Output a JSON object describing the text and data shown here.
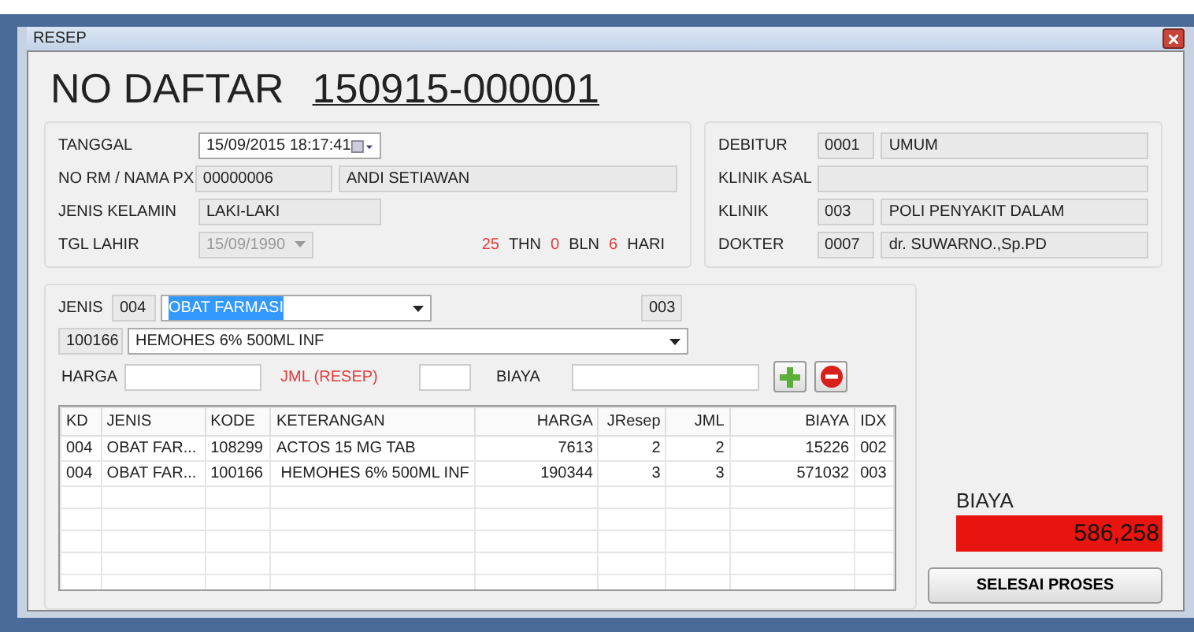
{
  "window": {
    "title": "RESEP"
  },
  "header": {
    "label": "NO DAFTAR",
    "value": "150915-000001"
  },
  "patient": {
    "tanggal": {
      "label": "TANGGAL",
      "value": "15/09/2015 18:17:41"
    },
    "no_rm": {
      "label": "NO RM / NAMA PX",
      "code": "00000006",
      "name": "ANDI SETIAWAN"
    },
    "jenis_kelamin": {
      "label": "JENIS KELAMIN",
      "value": "LAKI-LAKI"
    },
    "tgl_lahir": {
      "label": "TGL LAHIR",
      "value": "15/09/1990",
      "disabled": true
    },
    "age": [
      {
        "value": "25",
        "unit": "THN"
      },
      {
        "value": "0",
        "unit": "BLN"
      },
      {
        "value": "6",
        "unit": "HARI"
      }
    ]
  },
  "registration": [
    {
      "label": "DEBITUR",
      "code": "0001",
      "name": "UMUM"
    },
    {
      "label": "KLINIK ASAL"
    },
    {
      "label": "KLINIK",
      "code": "003",
      "name": "POLI PENYAKIT DALAM"
    },
    {
      "label": "DOKTER",
      "code": "0007",
      "name": "dr. SUWARNO.,Sp.PD"
    }
  ],
  "entry": {
    "jenis": {
      "label": "JENIS",
      "code": "004",
      "value": "OBAT FARMASI",
      "text_selected": true
    },
    "index_code": "003",
    "obat": {
      "code": "100166",
      "value": "HEMOHES 6% 500ML INF"
    },
    "fields": [
      {
        "label": "HARGA",
        "required": false
      },
      {
        "label": "JML (RESEP)",
        "required": true
      },
      {
        "label": "BIAYA",
        "required": false
      }
    ]
  },
  "table": {
    "columns": [
      {
        "label": "KD",
        "numeric": false
      },
      {
        "label": "JENIS",
        "numeric": false
      },
      {
        "label": "KODE",
        "numeric": false
      },
      {
        "label": "KETERANGAN",
        "numeric": false
      },
      {
        "label": "HARGA",
        "numeric": true
      },
      {
        "label": "JResep",
        "numeric": true
      },
      {
        "label": "JML",
        "numeric": true
      },
      {
        "label": "BIAYA",
        "numeric": true
      },
      {
        "label": "IDX",
        "numeric": false
      }
    ],
    "rows": [
      [
        "004",
        "OBAT FAR...",
        "108299",
        "ACTOS 15 MG TAB",
        "7613",
        "2",
        "2",
        "15226",
        "002"
      ],
      [
        "004",
        "OBAT FAR...",
        "100166",
        " HEMOHES 6% 500ML INF",
        "190344",
        "3",
        "3",
        "571032",
        "003"
      ]
    ]
  },
  "total": {
    "label": "BIAYA",
    "value": "586,258"
  },
  "finish_button": "SELESAI PROSES"
}
